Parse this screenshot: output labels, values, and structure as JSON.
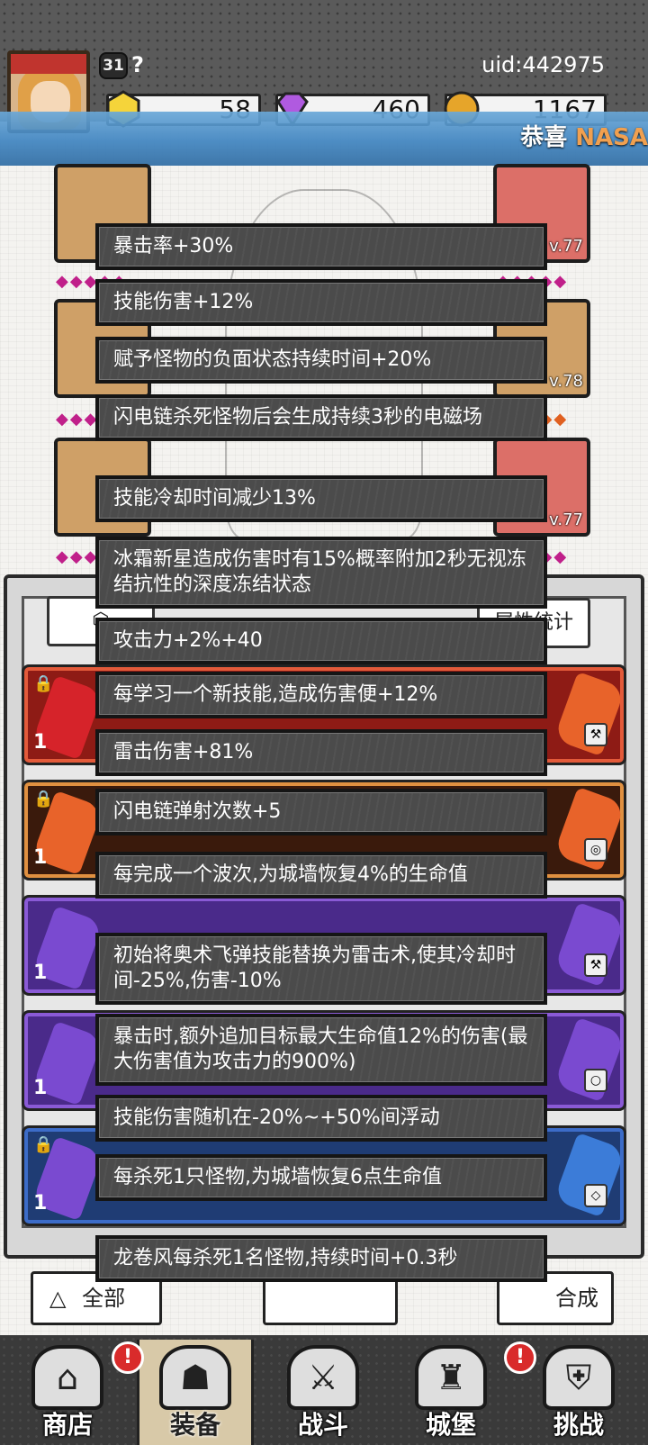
{
  "player": {
    "level": "31",
    "name": "?",
    "uid": "uid:442975"
  },
  "currencies": [
    {
      "name": "gold-gem",
      "value": "58",
      "color": "#f5d43a"
    },
    {
      "name": "purple-diamond",
      "value": "460",
      "color": "#b05ae0"
    },
    {
      "name": "coin",
      "value": "1167",
      "color": "#e6a52a"
    }
  ],
  "notice": {
    "prefix": "恭喜",
    "highlight": "NASA"
  },
  "equipment": {
    "right_levels": [
      "v.77",
      "v.78",
      "v.77"
    ]
  },
  "panel": {
    "stats_button": "属性统计",
    "bottom_left_button": "全部",
    "bottom_right_button": "合成",
    "row_counts": [
      "1",
      "1",
      "1",
      "1",
      "1"
    ]
  },
  "tooltips": [
    "暴击率+30%",
    "技能伤害+12%",
    "赋予怪物的负面状态持续时间+20%",
    "闪电链杀死怪物后会生成持续3秒的电磁场",
    "技能冷却时间减少13%",
    "冰霜新星造成伤害时有15%概率附加2秒无视冻结抗性的深度冻结状态",
    "攻击力+2%+40",
    "每学习一个新技能,造成伤害便+12%",
    "雷击伤害+81%",
    "闪电链弹射次数+5",
    "每完成一个波次,为城墙恢复4%的生命值",
    "初始将奥术飞弹技能替换为雷击术,使其冷却时间-25%,伤害-10%",
    "暴击时,额外追加目标最大生命值12%的伤害(最大伤害值为攻击力的900%)",
    "技能伤害随机在-20%~+50%间浮动",
    "每杀死1只怪物,为城墙恢复6点生命值",
    "龙卷风每杀死1名怪物,持续时间+0.3秒"
  ],
  "nav": [
    {
      "label": "商店",
      "icon": "shop-icon"
    },
    {
      "label": "装备",
      "icon": "bag-icon"
    },
    {
      "label": "战斗",
      "icon": "swords-icon"
    },
    {
      "label": "城堡",
      "icon": "castle-icon"
    },
    {
      "label": "挑战",
      "icon": "shield-icon"
    }
  ],
  "alert": "!"
}
